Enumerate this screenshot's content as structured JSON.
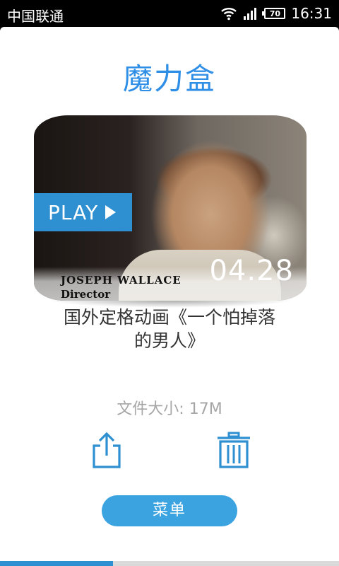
{
  "status_bar": {
    "carrier": "中国联通",
    "battery": "70",
    "time": "16:31"
  },
  "app": {
    "title": "魔力盒"
  },
  "video": {
    "play_label": "PLAY",
    "duration": "04.28",
    "person_name": "JOSEPH WALLACE",
    "person_role": "Director",
    "title": "国外定格动画《一个怕掉落的男人》",
    "file_size": "文件大小: 17M"
  },
  "actions": {
    "share_icon": "share-icon",
    "delete_icon": "trash-icon"
  },
  "menu": {
    "label": "菜单"
  },
  "pager": {
    "progress": 0.333
  },
  "colors": {
    "accent": "#2e8fd1",
    "title": "#2f8fe6",
    "menu_button": "#3aa3e0"
  }
}
